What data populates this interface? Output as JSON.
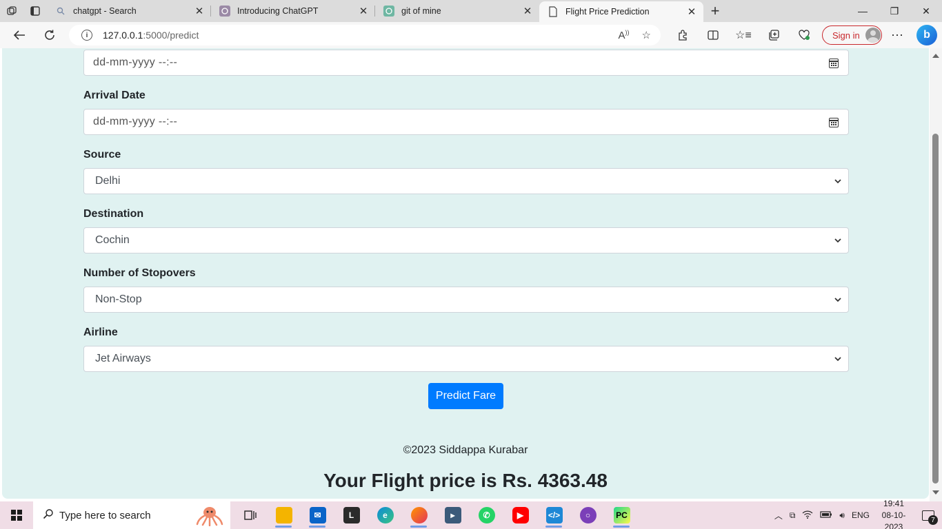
{
  "browser": {
    "tabs": [
      {
        "title": "chatgpt - Search",
        "icon": "search-icon"
      },
      {
        "title": "Introducing ChatGPT",
        "icon": "openai-icon"
      },
      {
        "title": "git of mine",
        "icon": "openai-icon"
      },
      {
        "title": "Flight Price Prediction",
        "icon": "page-icon",
        "active": true
      }
    ],
    "url_host": "127.0.0.1",
    "url_path": ":5000/predict",
    "signin_label": "Sign in"
  },
  "form": {
    "departure": {
      "placeholder": "dd-mm-yyyy --:--"
    },
    "arrival": {
      "label": "Arrival Date",
      "placeholder": "dd-mm-yyyy --:--"
    },
    "source": {
      "label": "Source",
      "value": "Delhi"
    },
    "destination": {
      "label": "Destination",
      "value": "Cochin"
    },
    "stopovers": {
      "label": "Number of Stopovers",
      "value": "Non-Stop"
    },
    "airline": {
      "label": "Airline",
      "value": "Jet Airways"
    },
    "submit_label": "Predict Fare"
  },
  "footer": {
    "copyright": "©2023 Siddappa Kurabar"
  },
  "result": {
    "text": "Your Flight price is Rs. 4363.48"
  },
  "taskbar": {
    "search_placeholder": "Type here to search",
    "language": "ENG",
    "time": "19:41",
    "date": "08-10-2023",
    "notification_count": "7"
  },
  "colors": {
    "page_bg": "#e0f2f1",
    "button": "#007bff",
    "signin_accent": "#c8262b"
  }
}
